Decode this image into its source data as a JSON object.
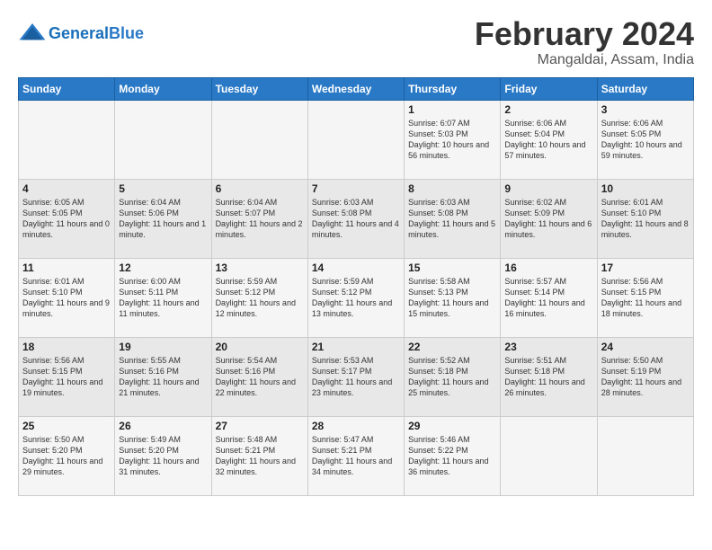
{
  "header": {
    "logo_general": "General",
    "logo_blue": "Blue",
    "month_title": "February 2024",
    "location": "Mangaldai, Assam, India"
  },
  "weekdays": [
    "Sunday",
    "Monday",
    "Tuesday",
    "Wednesday",
    "Thursday",
    "Friday",
    "Saturday"
  ],
  "weeks": [
    [
      {
        "day": "",
        "info": ""
      },
      {
        "day": "",
        "info": ""
      },
      {
        "day": "",
        "info": ""
      },
      {
        "day": "",
        "info": ""
      },
      {
        "day": "1",
        "info": "Sunrise: 6:07 AM\nSunset: 5:03 PM\nDaylight: 10 hours\nand 56 minutes."
      },
      {
        "day": "2",
        "info": "Sunrise: 6:06 AM\nSunset: 5:04 PM\nDaylight: 10 hours\nand 57 minutes."
      },
      {
        "day": "3",
        "info": "Sunrise: 6:06 AM\nSunset: 5:05 PM\nDaylight: 10 hours\nand 59 minutes."
      }
    ],
    [
      {
        "day": "4",
        "info": "Sunrise: 6:05 AM\nSunset: 5:05 PM\nDaylight: 11 hours\nand 0 minutes."
      },
      {
        "day": "5",
        "info": "Sunrise: 6:04 AM\nSunset: 5:06 PM\nDaylight: 11 hours\nand 1 minute."
      },
      {
        "day": "6",
        "info": "Sunrise: 6:04 AM\nSunset: 5:07 PM\nDaylight: 11 hours\nand 2 minutes."
      },
      {
        "day": "7",
        "info": "Sunrise: 6:03 AM\nSunset: 5:08 PM\nDaylight: 11 hours\nand 4 minutes."
      },
      {
        "day": "8",
        "info": "Sunrise: 6:03 AM\nSunset: 5:08 PM\nDaylight: 11 hours\nand 5 minutes."
      },
      {
        "day": "9",
        "info": "Sunrise: 6:02 AM\nSunset: 5:09 PM\nDaylight: 11 hours\nand 6 minutes."
      },
      {
        "day": "10",
        "info": "Sunrise: 6:01 AM\nSunset: 5:10 PM\nDaylight: 11 hours\nand 8 minutes."
      }
    ],
    [
      {
        "day": "11",
        "info": "Sunrise: 6:01 AM\nSunset: 5:10 PM\nDaylight: 11 hours\nand 9 minutes."
      },
      {
        "day": "12",
        "info": "Sunrise: 6:00 AM\nSunset: 5:11 PM\nDaylight: 11 hours\nand 11 minutes."
      },
      {
        "day": "13",
        "info": "Sunrise: 5:59 AM\nSunset: 5:12 PM\nDaylight: 11 hours\nand 12 minutes."
      },
      {
        "day": "14",
        "info": "Sunrise: 5:59 AM\nSunset: 5:12 PM\nDaylight: 11 hours\nand 13 minutes."
      },
      {
        "day": "15",
        "info": "Sunrise: 5:58 AM\nSunset: 5:13 PM\nDaylight: 11 hours\nand 15 minutes."
      },
      {
        "day": "16",
        "info": "Sunrise: 5:57 AM\nSunset: 5:14 PM\nDaylight: 11 hours\nand 16 minutes."
      },
      {
        "day": "17",
        "info": "Sunrise: 5:56 AM\nSunset: 5:15 PM\nDaylight: 11 hours\nand 18 minutes."
      }
    ],
    [
      {
        "day": "18",
        "info": "Sunrise: 5:56 AM\nSunset: 5:15 PM\nDaylight: 11 hours\nand 19 minutes."
      },
      {
        "day": "19",
        "info": "Sunrise: 5:55 AM\nSunset: 5:16 PM\nDaylight: 11 hours\nand 21 minutes."
      },
      {
        "day": "20",
        "info": "Sunrise: 5:54 AM\nSunset: 5:16 PM\nDaylight: 11 hours\nand 22 minutes."
      },
      {
        "day": "21",
        "info": "Sunrise: 5:53 AM\nSunset: 5:17 PM\nDaylight: 11 hours\nand 23 minutes."
      },
      {
        "day": "22",
        "info": "Sunrise: 5:52 AM\nSunset: 5:18 PM\nDaylight: 11 hours\nand 25 minutes."
      },
      {
        "day": "23",
        "info": "Sunrise: 5:51 AM\nSunset: 5:18 PM\nDaylight: 11 hours\nand 26 minutes."
      },
      {
        "day": "24",
        "info": "Sunrise: 5:50 AM\nSunset: 5:19 PM\nDaylight: 11 hours\nand 28 minutes."
      }
    ],
    [
      {
        "day": "25",
        "info": "Sunrise: 5:50 AM\nSunset: 5:20 PM\nDaylight: 11 hours\nand 29 minutes."
      },
      {
        "day": "26",
        "info": "Sunrise: 5:49 AM\nSunset: 5:20 PM\nDaylight: 11 hours\nand 31 minutes."
      },
      {
        "day": "27",
        "info": "Sunrise: 5:48 AM\nSunset: 5:21 PM\nDaylight: 11 hours\nand 32 minutes."
      },
      {
        "day": "28",
        "info": "Sunrise: 5:47 AM\nSunset: 5:21 PM\nDaylight: 11 hours\nand 34 minutes."
      },
      {
        "day": "29",
        "info": "Sunrise: 5:46 AM\nSunset: 5:22 PM\nDaylight: 11 hours\nand 36 minutes."
      },
      {
        "day": "",
        "info": ""
      },
      {
        "day": "",
        "info": ""
      }
    ]
  ]
}
